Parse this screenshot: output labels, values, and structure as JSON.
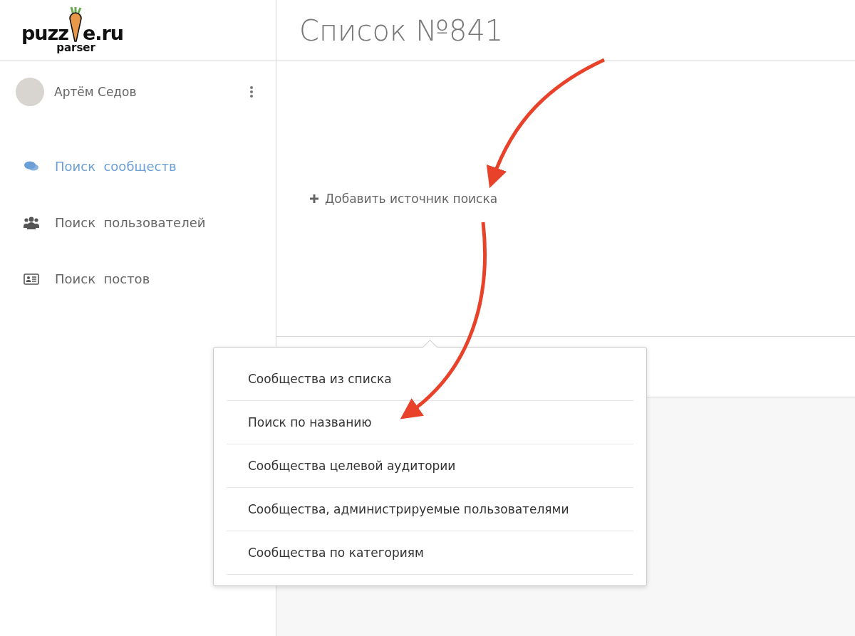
{
  "logo": {
    "left": "puzz",
    "right": "e.ru",
    "sub": "parser"
  },
  "user": {
    "name": "Артём Седов"
  },
  "nav": [
    {
      "label": "Поиск  сообществ",
      "kind": "comments",
      "selected": true
    },
    {
      "label": "Поиск  пользователей",
      "kind": "users",
      "selected": false
    },
    {
      "label": "Поиск  постов",
      "kind": "card",
      "selected": false
    }
  ],
  "page": {
    "title": "Список №841",
    "add_source": "Добавить источник поиска"
  },
  "dropdown": {
    "items": [
      "Сообщества из списка",
      "Поиск по названию",
      "Сообщества целевой аудитории",
      "Сообщества, администрируемые пользователями",
      "Сообщества по категориям"
    ]
  }
}
